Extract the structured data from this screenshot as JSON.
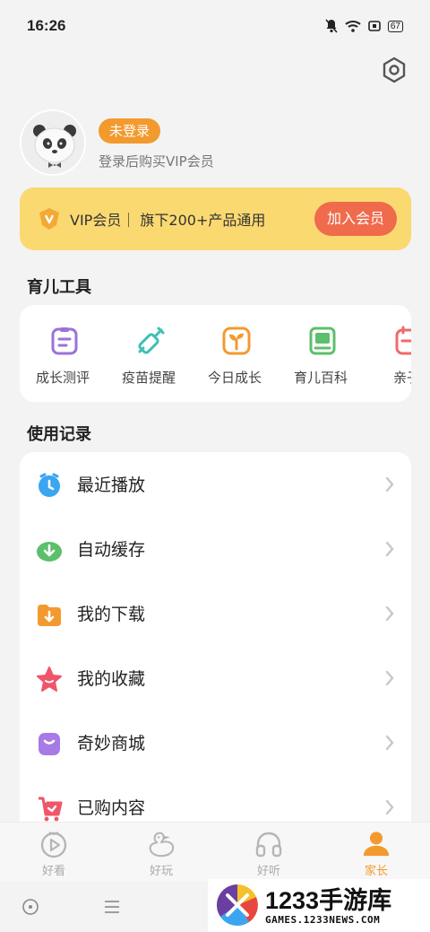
{
  "status_bar": {
    "time": "16:26",
    "battery": "67"
  },
  "profile": {
    "login_status": "未登录",
    "hint": "登录后购买VIP会员"
  },
  "vip_banner": {
    "text": "VIP会员｜ 旗下200+产品通用",
    "button": "加入会员"
  },
  "tools_section": {
    "title": "育儿工具",
    "items": [
      {
        "label": "成长测评",
        "icon": "clipboard-icon",
        "color": "#9b72d8"
      },
      {
        "label": "疫苗提醒",
        "icon": "syringe-icon",
        "color": "#3cc0b5"
      },
      {
        "label": "今日成长",
        "icon": "sprout-icon",
        "color": "#f39a2f"
      },
      {
        "label": "育儿百科",
        "icon": "book-icon",
        "color": "#5cbf6b"
      },
      {
        "label": "亲子",
        "icon": "calendar-icon",
        "color": "#f06a6a"
      }
    ]
  },
  "records_section": {
    "title": "使用记录",
    "items": [
      {
        "label": "最近播放",
        "icon": "clock-icon",
        "color": "#3aa6f0"
      },
      {
        "label": "自动缓存",
        "icon": "download-cloud-icon",
        "color": "#5cbf6b"
      },
      {
        "label": "我的下载",
        "icon": "folder-download-icon",
        "color": "#f39a2f"
      },
      {
        "label": "我的收藏",
        "icon": "star-icon",
        "color": "#f0556a"
      },
      {
        "label": "奇妙商城",
        "icon": "shopping-bag-icon",
        "color": "#a77ae6"
      },
      {
        "label": "已购内容",
        "icon": "cart-icon",
        "color": "#f0556a"
      }
    ]
  },
  "tab_bar": {
    "tabs": [
      {
        "label": "好看",
        "icon": "play-icon",
        "active": false
      },
      {
        "label": "好玩",
        "icon": "duck-icon",
        "active": false
      },
      {
        "label": "好听",
        "icon": "headphones-icon",
        "active": false
      },
      {
        "label": "家长",
        "icon": "user-icon",
        "active": true
      }
    ],
    "active_color": "#f39a2f",
    "inactive_color": "#aaaaaa"
  },
  "watermark": {
    "title": "1233手游库",
    "subtitle": "GAMES.1233NEWS.COM"
  }
}
